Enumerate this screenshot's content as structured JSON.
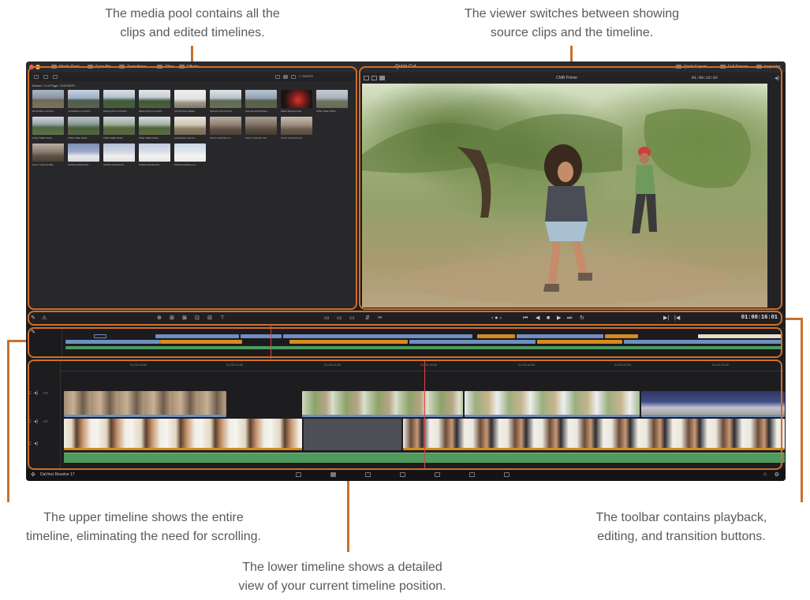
{
  "callouts": {
    "media_pool": [
      "The media pool contains all the",
      "clips and edited timelines."
    ],
    "viewer": [
      "The viewer switches between showing",
      "source clips and the timeline."
    ],
    "upper_timeline": [
      "The upper timeline shows the entire",
      "timeline, eliminating the need for scrolling."
    ],
    "lower_timeline": [
      "The lower timeline shows a detailed",
      "view of your current timeline position."
    ],
    "toolbar": [
      "The toolbar contains playback,",
      "editing, and transition buttons."
    ]
  },
  "app": {
    "tabs": [
      "Media Pool",
      "Sync Bin",
      "Transitions",
      "Titles",
      "Effects"
    ],
    "project_title": "Quick Cut",
    "right_buttons": [
      "Quick Export",
      "Full Screen",
      "Inspector"
    ]
  },
  "media_pool": {
    "search_placeholder": "Search",
    "breadcrumb": "Master / Cut Page / SCENERY",
    "clips": [
      "BOXFIRE CLOUDS...",
      "JUNIPERS CLOUDS...",
      "MESQUITE CLOUDS...",
      "MESQUITE CLOUDS...",
      "MOUNTAIN HIKER...",
      "ORGAN MOUNTAIN...",
      "ORGAN MOUNTAIN...",
      "PENA BLANCA SR...",
      "PINE TREE TRAIL...",
      "PINE TREE TRAIL...",
      "PINE TREE TRAIL...",
      "PINE TREE TRAIL...",
      "PINE TREE TRAIL...",
      "SALEDGE CANYO...",
      "SLOT CANYON LO...",
      "SLOT CANYON TO...",
      "SLOT CANYON HO...",
      "SLOT CANYON BE...",
      "WHITE SANDS DU...",
      "WHITE SANDS DU...",
      "WHITE SANDS RU...",
      "WHITE SANDS.mov"
    ]
  },
  "viewer": {
    "mode": "Quick Cut",
    "source_label": "CMB Primer",
    "timecode_small": "01:00:16:02"
  },
  "toolbar": {
    "timecode": "01:00:16:01",
    "transport": [
      "⏮",
      "◀",
      "■",
      "▶",
      "⏭",
      "↻"
    ]
  },
  "lower_timeline": {
    "ruler_ticks": [
      "01:00:10:00",
      "01:00:12:00",
      "01:00:14:00",
      "01:00:16:00",
      "01:00:18:00",
      "01:00:20:00",
      "01:00:22:00"
    ],
    "tracks": [
      "V2",
      "V1",
      "A1"
    ]
  },
  "bottombar": {
    "app_name": "DaVinci Resolve 17",
    "pages": [
      "Media",
      "Cut",
      "Edit",
      "Fusion",
      "Color",
      "Fairlight",
      "Deliver"
    ]
  },
  "colors": {
    "accent": "#cf6f29",
    "timeline_blue": "#6f8fc2",
    "timeline_orange": "#d88a1e",
    "timeline_green": "#4f9a5e",
    "playhead": "#e14242"
  }
}
